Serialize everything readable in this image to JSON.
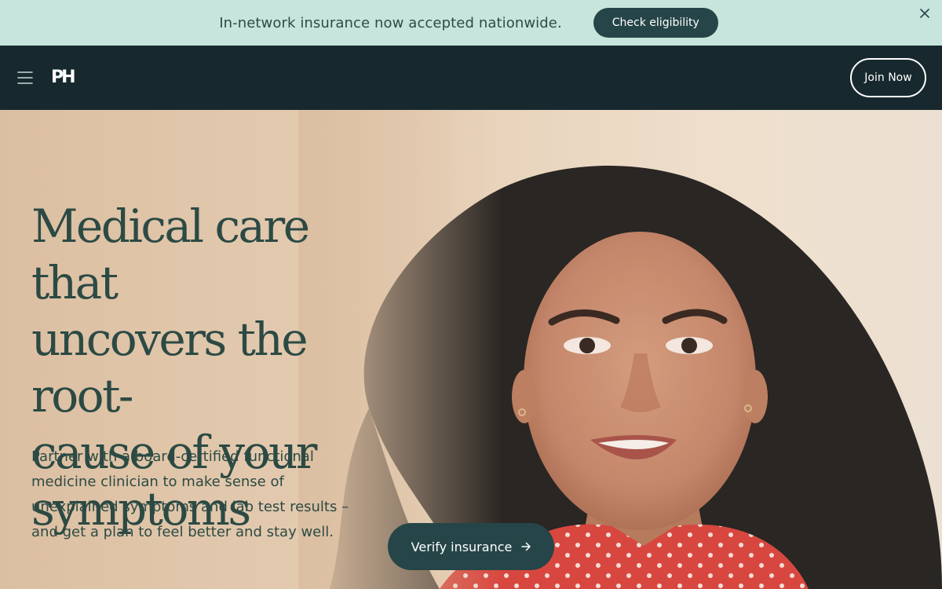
{
  "banner": {
    "text": "In-network insurance now accepted nationwide.",
    "button_label": "Check eligibility",
    "close_icon": "close-icon"
  },
  "nav": {
    "menu_icon": "hamburger-menu-icon",
    "logo_text": "PH",
    "join_label": "Join Now"
  },
  "hero": {
    "title_lines": [
      "Medical care that",
      "uncovers the root-",
      "cause of your",
      "symptoms"
    ],
    "subtitle": "Partner with a board-certified functional medicine clinician to make sense of unexplained symptoms and lab test results – and get a plan to feel better and stay well.",
    "cta_label": "Verify insurance",
    "cta_icon": "arrow-right-icon"
  },
  "colors": {
    "banner_bg": "#c7e5dc",
    "nav_bg": "#17292e",
    "brand_dark": "#264548",
    "heading_text": "#2c4a44"
  }
}
